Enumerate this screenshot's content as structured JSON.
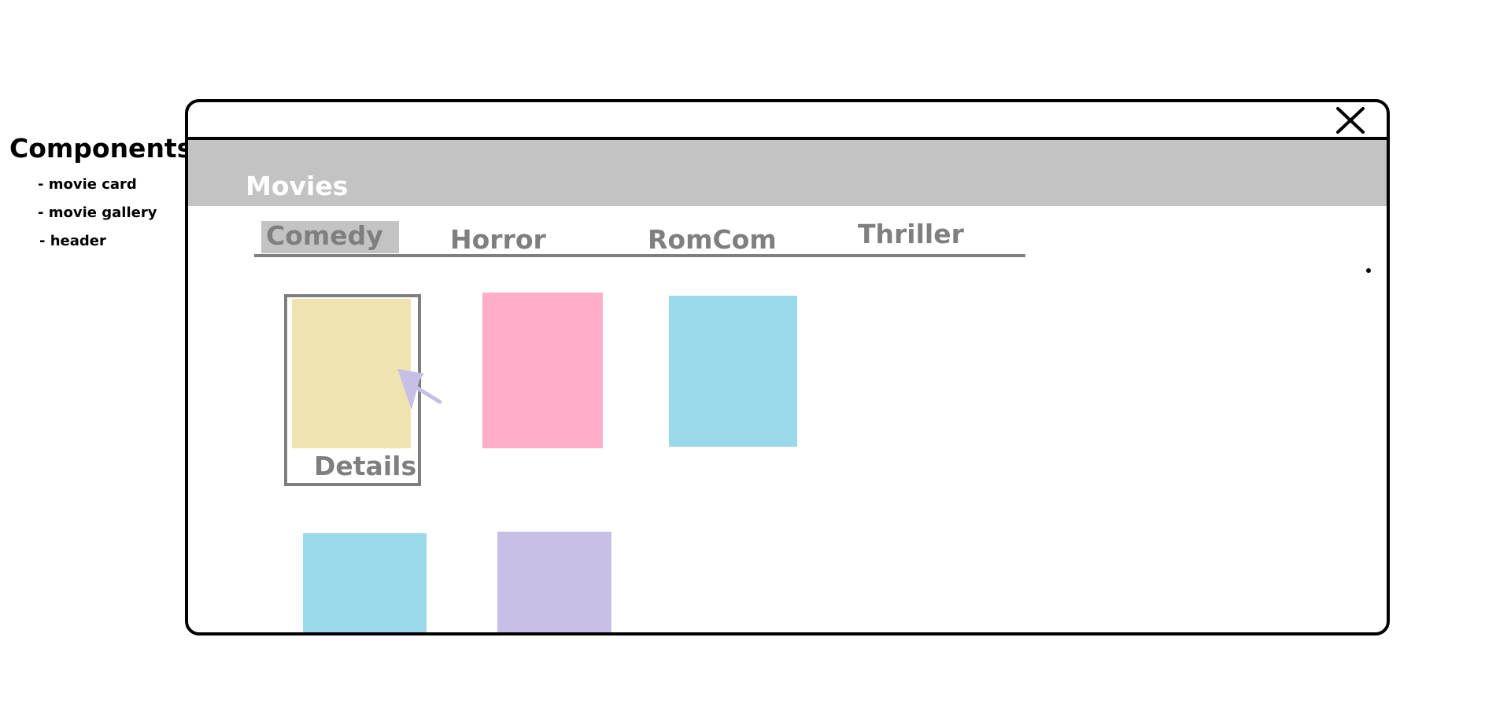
{
  "notes": {
    "title": "Components",
    "items": [
      "- movie card",
      "- movie gallery",
      "- header"
    ]
  },
  "window": {
    "close_icon": "close-x-icon"
  },
  "header": {
    "title": "Movies",
    "background": "#c3c3c3"
  },
  "tabs": [
    {
      "label": "Comedy",
      "active": true
    },
    {
      "label": "Horror",
      "active": false
    },
    {
      "label": "RomCom",
      "active": false
    },
    {
      "label": "Thriller",
      "active": false
    }
  ],
  "gallery": {
    "cards": [
      {
        "color": "#efe4b0",
        "selected": true,
        "details_label": "Details"
      },
      {
        "color": "#ffaec9",
        "selected": false
      },
      {
        "color": "#99d9ea",
        "selected": false
      },
      {
        "color": "#99d9ea",
        "selected": false
      },
      {
        "color": "#c8bfe7",
        "selected": false
      }
    ]
  },
  "colors": {
    "tab_text": "#7f7f7f",
    "border": "#000000",
    "cursor": "#c8bfe7"
  }
}
